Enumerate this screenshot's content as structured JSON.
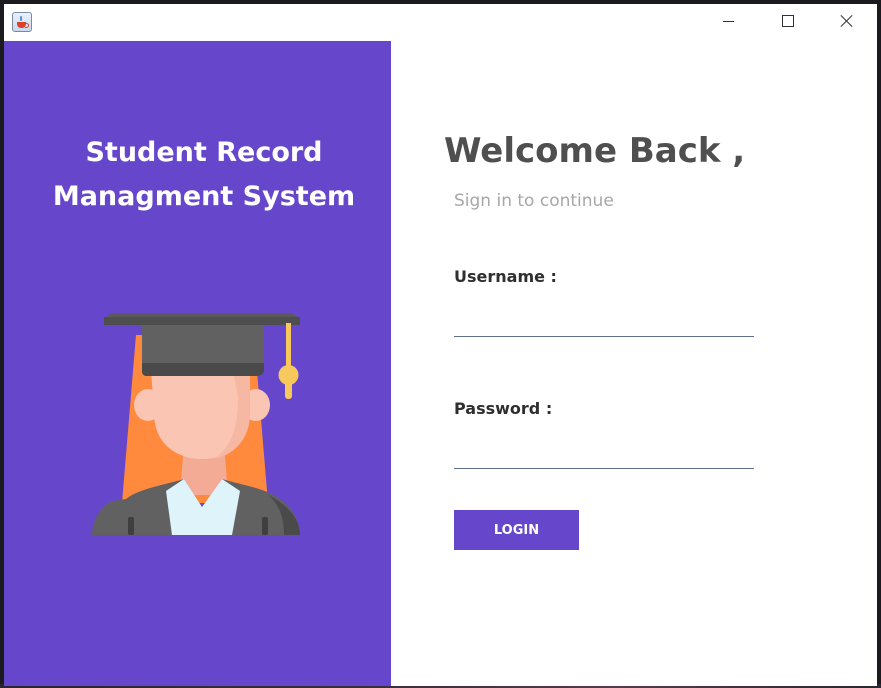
{
  "window": {
    "controls": {
      "minimize_icon": "minimize-icon",
      "maximize_icon": "maximize-icon",
      "close_icon": "close-icon"
    },
    "app_icon": "java-coffee-cup-icon"
  },
  "left_panel": {
    "title_line1": "Student Record",
    "title_line2": "Managment System",
    "illustration": "graduate-student-icon",
    "background": "#6647cc"
  },
  "login": {
    "welcome": "Welcome Back ,",
    "subtitle": "Sign in to continue",
    "username_label": "Username :",
    "username_value": "",
    "password_label": "Password :",
    "password_value": "",
    "login_button": "LOGIN"
  },
  "colors": {
    "accent": "#6647cc",
    "heading": "#4f4f4f",
    "muted": "#a7a7a7",
    "underline": "#5f6f8f"
  }
}
